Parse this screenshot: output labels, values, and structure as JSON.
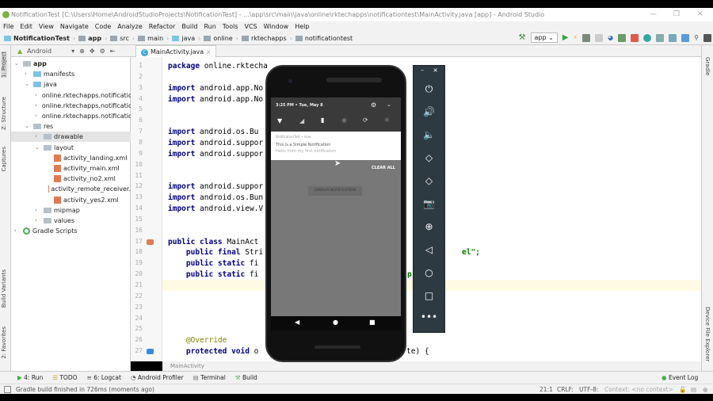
{
  "window": {
    "title": "NotificationTest [C:\\Users\\Home\\AndroidStudioProjects\\NotificationTest] - ...\\app\\src\\main\\java\\online\\rktechapps\\notificationtest\\MainActivity.java [app] - Android Studio"
  },
  "menu": [
    "File",
    "Edit",
    "View",
    "Navigate",
    "Code",
    "Analyze",
    "Refactor",
    "Build",
    "Run",
    "Tools",
    "VCS",
    "Window",
    "Help"
  ],
  "breadcrumb": [
    "NotificationTest",
    "app",
    "src",
    "main",
    "java",
    "online",
    "rktechapps",
    "notificationtest"
  ],
  "toolbar": {
    "run_config": "app"
  },
  "left_tabs": [
    "1: Project",
    "Z: Structure",
    "Captures",
    "Build Variants",
    "2: Favorites"
  ],
  "right_tabs": [
    "Gradle",
    "Device File Explorer"
  ],
  "project": {
    "view_selector": "Android",
    "tree": [
      {
        "label": "app",
        "depth": 0,
        "icon": "module-folder",
        "expanded": true
      },
      {
        "label": "manifests",
        "depth": 1,
        "icon": "folder",
        "expanded": false
      },
      {
        "label": "java",
        "depth": 1,
        "icon": "folder",
        "expanded": true
      },
      {
        "label": "online.rktechapps.notificatio",
        "depth": 2,
        "icon": "package",
        "expanded": false
      },
      {
        "label": "online.rktechapps.notificatio",
        "depth": 2,
        "icon": "package",
        "expanded": false
      },
      {
        "label": "online.rktechapps.notificatio",
        "depth": 2,
        "icon": "package",
        "expanded": false
      },
      {
        "label": "res",
        "depth": 1,
        "icon": "folder",
        "expanded": true
      },
      {
        "label": "drawable",
        "depth": 2,
        "icon": "folder",
        "expanded": false,
        "selected": true
      },
      {
        "label": "layout",
        "depth": 2,
        "icon": "folder",
        "expanded": true
      },
      {
        "label": "activity_landing.xml",
        "depth": 3,
        "icon": "xml-file"
      },
      {
        "label": "activity_main.xml",
        "depth": 3,
        "icon": "xml-file"
      },
      {
        "label": "activity_no2.xml",
        "depth": 3,
        "icon": "xml-file"
      },
      {
        "label": "activity_remote_receiver.",
        "depth": 3,
        "icon": "xml-file"
      },
      {
        "label": "activity_yes2.xml",
        "depth": 3,
        "icon": "xml-file"
      },
      {
        "label": "mipmap",
        "depth": 2,
        "icon": "folder",
        "expanded": false
      },
      {
        "label": "values",
        "depth": 2,
        "icon": "folder",
        "expanded": false
      },
      {
        "label": "Gradle Scripts",
        "depth": 0,
        "icon": "gradle",
        "expanded": false
      }
    ]
  },
  "editor": {
    "tab": "MainActivity.java",
    "current_line": 21,
    "line_numbers": [
      "1",
      "2",
      "3",
      "4",
      "5",
      "6",
      "7",
      "8",
      "9",
      "10",
      "11",
      "12",
      "13",
      "14",
      "15",
      "16",
      "17",
      "18",
      "19",
      "20",
      "21",
      "22",
      "23",
      "24",
      "25",
      "26",
      "27"
    ],
    "lines": [
      {
        "n": 1,
        "kw": "package",
        "rest": " online.rktecha"
      },
      {
        "n": 3,
        "kw": "import",
        "rest": " android.app.No"
      },
      {
        "n": 4,
        "kw": "import",
        "rest": " android.app.No"
      },
      {
        "n": 7,
        "kw": "import",
        "rest": " android.os.Bu"
      },
      {
        "n": 8,
        "kw": "import",
        "rest": " android.suppor"
      },
      {
        "n": 9,
        "kw": "import",
        "rest": " android.suppor"
      },
      {
        "n": 12,
        "kw": "import",
        "rest": " android.suppor"
      },
      {
        "n": 13,
        "kw": "import",
        "rest": " android.os.Bun"
      },
      {
        "n": 14,
        "kw": "import",
        "rest": " android.view.V"
      },
      {
        "n": 17,
        "kw": "public class",
        "rest": " MainAct"
      },
      {
        "n": 18,
        "kw": "    public final",
        "rest": " Stri"
      },
      {
        "n": 19,
        "kw": "    public static",
        "rest": " fi"
      },
      {
        "n": 20,
        "kw": "    public static",
        "rest": " fi"
      },
      {
        "n": 27,
        "kw": "    protected void",
        "rest": " o"
      }
    ],
    "annotation_line": {
      "n": 26,
      "text": "    @Override"
    },
    "right_fragments": [
      {
        "n": 18,
        "text": "el\";"
      },
      {
        "n": 20,
        "text": "p"
      },
      {
        "n": 27,
        "text": "te) {"
      }
    ],
    "footer": "MainActivity"
  },
  "emulator": {
    "status_time": "3:25 PM • Tue, May 8",
    "notification": {
      "app": "NotificationTest • now",
      "title": "This is a Simple Notification",
      "text": "Hello from my first notification"
    },
    "clear_all": "CLEAR ALL",
    "app_button": "DISPLAY NOTIFICATION",
    "controls": [
      "power",
      "volume-up",
      "volume-down",
      "rotate-left",
      "rotate-right",
      "screenshot",
      "zoom",
      "back",
      "home",
      "overview",
      "more"
    ]
  },
  "bottom_tabs": [
    "4: Run",
    "TODO",
    "6: Logcat",
    "Android Profiler",
    "Terminal",
    "Build"
  ],
  "event_log": "Event Log",
  "status": {
    "message": "Gradle build finished in 726ms (moments ago)",
    "position": "21:1",
    "line_sep": "CRLF:",
    "encoding": "UTF-8:",
    "context": "Context: <no context>"
  }
}
